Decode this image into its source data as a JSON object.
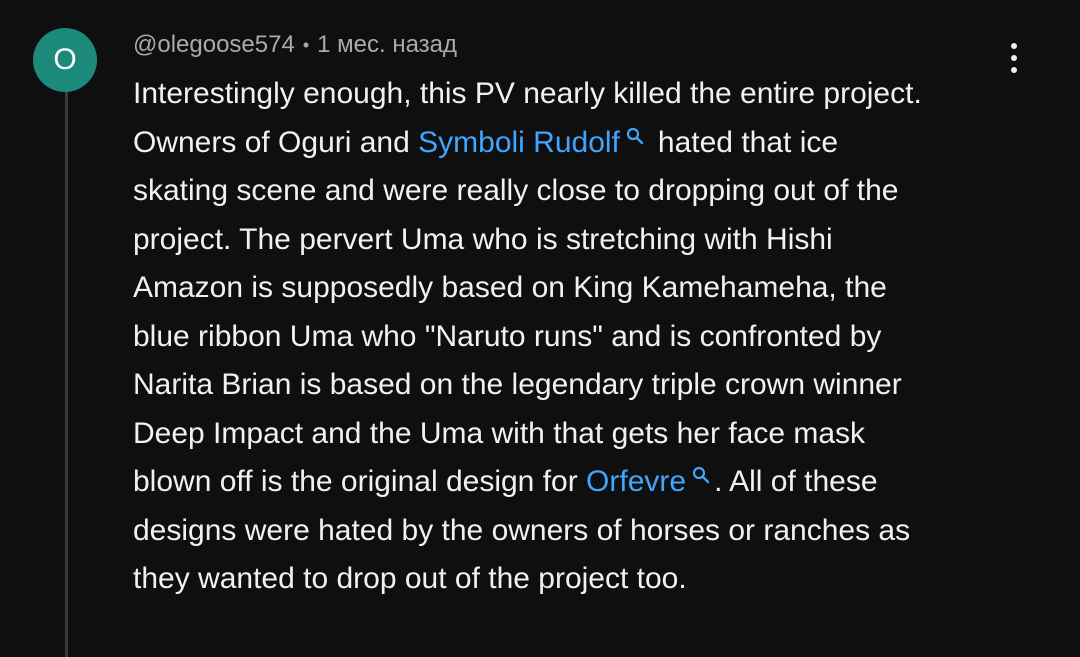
{
  "avatar": {
    "letter": "O",
    "color": "#1b8a7a"
  },
  "comment": {
    "author": "@olegoose574",
    "separator": "•",
    "timestamp": "1 мес. назад",
    "lines": {
      "l1": "Interestingly enough, this PV nearly killed the entire project.",
      "l2_before": "Owners of Oguri and ",
      "l2_link": "Symboli Rudolf",
      "l2_after": "hated that ice",
      "l3": "skating scene and were really close to dropping out of the",
      "l4": "project. The pervert Uma who is stretching with Hishi",
      "l5": "Amazon is supposedly based on King Kamehameha, the",
      "l6": "blue ribbon Uma who \"Naruto runs\" and is confronted by",
      "l7": "Narita Brian is based on the legendary triple crown winner",
      "l8": "Deep Impact and the Uma with that gets her face mask",
      "l9_before": "blown off is the original design for ",
      "l9_link": "Orfevre",
      "l9_after": ". All of these",
      "l10": "designs were hated by the owners of horses or ranches as",
      "l11": "they wanted to drop out of the project too."
    }
  },
  "icons": {
    "menu": "more-vertical-icon",
    "search": "search-icon"
  },
  "colors": {
    "background": "#0f0f0f",
    "text": "#f1f1f1",
    "meta": "#aaaaaa",
    "link": "#3ea6ff",
    "thread_line": "#3a3a3a"
  }
}
